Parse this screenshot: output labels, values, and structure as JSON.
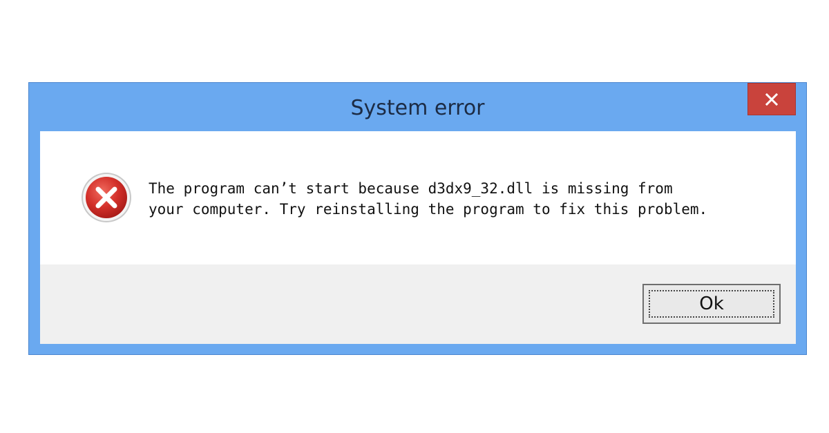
{
  "window": {
    "title": "System error",
    "close_icon": "close-icon"
  },
  "message": {
    "icon": "error-icon",
    "line1": "The program can’t start because d3dx9_32.dll is missing from",
    "line2": "your computer. Try reinstalling the program to fix this problem."
  },
  "buttons": {
    "ok_label": "Ok"
  },
  "colors": {
    "titlebar": "#6aa9f0",
    "close_button": "#c9433c",
    "footer": "#f0f0f0",
    "error_red": "#d32f2f"
  }
}
